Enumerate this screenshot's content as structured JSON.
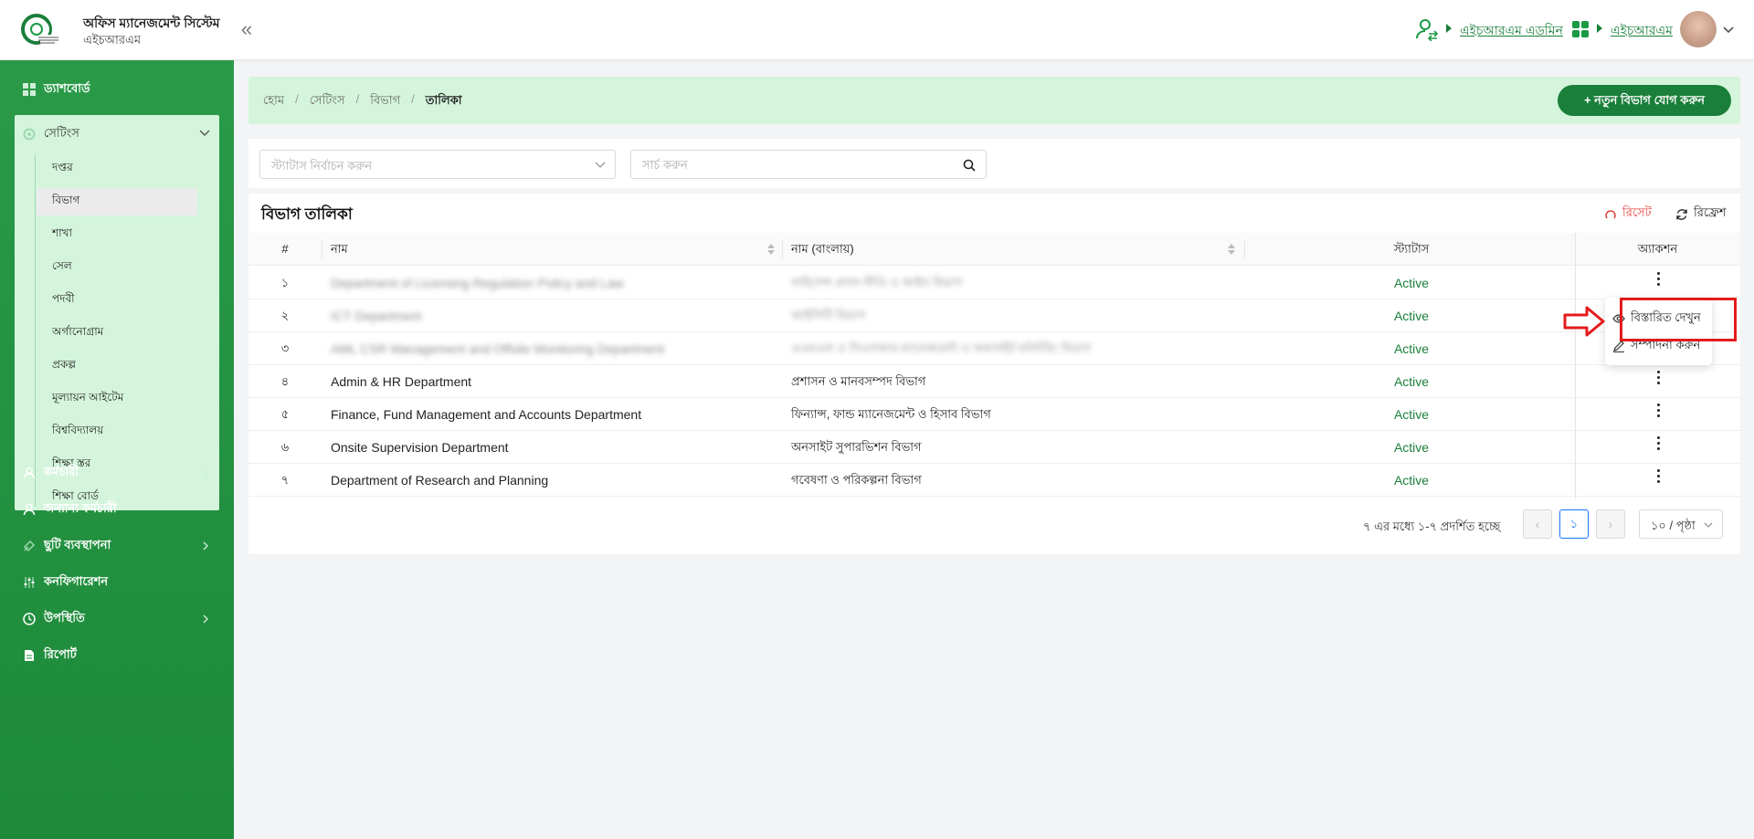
{
  "header": {
    "app_title": "অফিস ম্যানেজমেন্ট সিস্টেম",
    "app_subtitle": "এইচআরএম",
    "user_link": "এইচআরএম এডমিন",
    "module_link": "এইচআরএম",
    "colors": {
      "brand": "#1a7f3a",
      "accent": "#1a9a45"
    }
  },
  "sidebar": {
    "dashboard": "ড্যাশবোর্ড",
    "settings": "সেটিংস",
    "settings_items": [
      {
        "label": "দপ্তর",
        "active": false
      },
      {
        "label": "বিভাগ",
        "active": true
      },
      {
        "label": "শাখা",
        "active": false
      },
      {
        "label": "সেল",
        "active": false
      },
      {
        "label": "পদবী",
        "active": false
      },
      {
        "label": "অর্গানোগ্রাম",
        "active": false
      },
      {
        "label": "প্রকল্প",
        "active": false
      },
      {
        "label": "মূল্যায়ন আইটেম",
        "active": false
      },
      {
        "label": "বিশ্ববিদ্যালয়",
        "active": false
      },
      {
        "label": "শিক্ষা স্তর",
        "active": false
      },
      {
        "label": "শিক্ষা বোর্ড",
        "active": false
      }
    ],
    "items": [
      {
        "label": "কর্মচারী",
        "icon": "user-icon",
        "has_children": true
      },
      {
        "label": "অন্যান্য কর্মচারী",
        "icon": "user-icon",
        "has_children": false
      },
      {
        "label": "ছুটি ব্যবস্থাপনা",
        "icon": "leave-icon",
        "has_children": true
      },
      {
        "label": "কনফিগারেশন",
        "icon": "sliders-icon",
        "has_children": false
      },
      {
        "label": "উপস্থিতি",
        "icon": "clock-icon",
        "has_children": true
      },
      {
        "label": "রিপোর্ট",
        "icon": "document-icon",
        "has_children": false
      }
    ]
  },
  "breadcrumb": [
    "হোম",
    "সেটিংস",
    "বিভাগ",
    "তালিকা"
  ],
  "add_button": "+ নতুন বিভাগ যোগ করুন",
  "filters": {
    "status_placeholder": "স্ট্যাটাস নির্বাচন করুন",
    "search_placeholder": "সার্চ করুন"
  },
  "table": {
    "title": "বিভাগ তালিকা",
    "reset_label": "রিসেট",
    "refresh_label": "রিফ্রেশ",
    "columns": [
      "#",
      "নাম",
      "নাম (বাংলায়)",
      "স্ট্যাটাস",
      "অ্যাকশন"
    ],
    "rows": [
      {
        "num": "১",
        "name": "Department of Licensing Regulation Policy and Law",
        "name_bn": "লাইসেন্স প্রদান নীতি ও আইন বিভাগ",
        "status": "Active",
        "blurred": true
      },
      {
        "num": "২",
        "name": "ICT Department",
        "name_bn": "আইসিটি বিভাগ",
        "status": "Active",
        "blurred": true
      },
      {
        "num": "৩",
        "name": "AML CSR Management and Offsite Monitoring Department",
        "name_bn": "এএমএল ও সিএসআর ম্যানেজমেন্ট ও অফসাইট মনিটরিং বিভাগ",
        "status": "Active",
        "blurred": true
      },
      {
        "num": "৪",
        "name": "Admin & HR Department",
        "name_bn": "প্রশাসন ও মানবসম্পদ বিভাগ",
        "status": "Active",
        "blurred": false
      },
      {
        "num": "৫",
        "name": "Finance, Fund Management and Accounts Department",
        "name_bn": "ফিন্যান্স, ফান্ড ম্যানেজমেন্ট ও হিসাব বিভাগ",
        "status": "Active",
        "blurred": false
      },
      {
        "num": "৬",
        "name": "Onsite Supervision Department",
        "name_bn": "অনসাইট সুপারভিশন বিভাগ",
        "status": "Active",
        "blurred": false
      },
      {
        "num": "৭",
        "name": "Department of Research and Planning",
        "name_bn": "গবেষণা ও পরিকল্পনা বিভাগ",
        "status": "Active",
        "blurred": false
      }
    ]
  },
  "pagination": {
    "info": "৭ এর মধ্যে ১-৭ প্রদর্শিত হচ্ছে",
    "current_page": "১",
    "page_size": "১০ / পৃষ্ঠা"
  },
  "action_menu": {
    "view": "বিস্তারিত দেখুন",
    "edit": "সম্পাদনা করুন"
  }
}
